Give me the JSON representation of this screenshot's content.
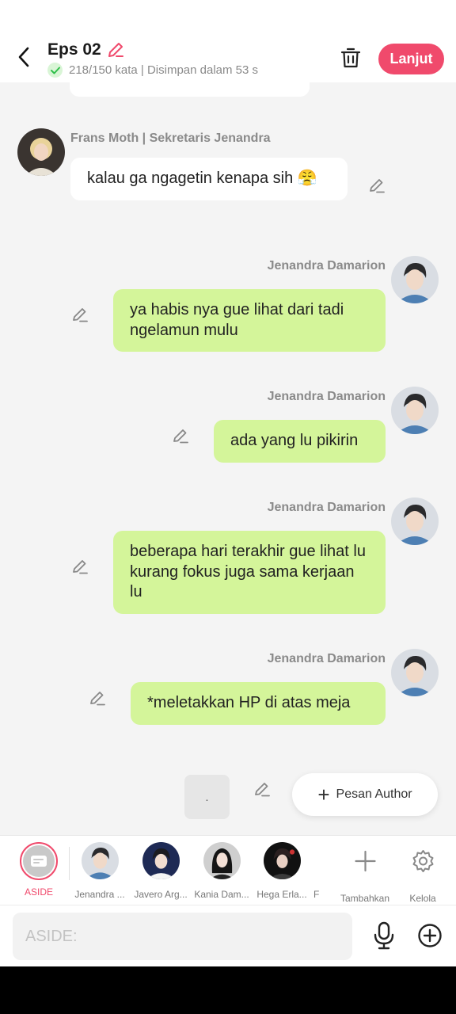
{
  "header": {
    "title": "Eps 02",
    "subtitle": "218/150 kata | Disimpan dalam 53 s",
    "next_label": "Lanjut"
  },
  "messages": [
    {
      "sender": "Frans Moth | Sekretaris Jenandra",
      "side": "left",
      "text": "kalau ga ngagetin kenapa sih 😤"
    },
    {
      "sender": "Jenandra Damarion",
      "side": "right",
      "text": "ya habis nya gue lihat dari tadi ngelamun mulu"
    },
    {
      "sender": "Jenandra Damarion",
      "side": "right",
      "text": "ada yang lu pikirin"
    },
    {
      "sender": "Jenandra Damarion",
      "side": "right",
      "text": "beberapa hari terakhir gue lihat lu kurang fokus juga sama kerjaan lu"
    },
    {
      "sender": "Jenandra Damarion",
      "side": "right",
      "text": "*meletakkan HP di atas meja"
    }
  ],
  "draft_box": ".",
  "author_button": "Pesan Author",
  "characters": {
    "aside": "ASIDE",
    "items": [
      "Jenandra ...",
      "Javero Arg...",
      "Kania Dam...",
      "Hega Erla...",
      "F"
    ],
    "add_label": "Tambahkan",
    "manage_label": "Kelola"
  },
  "input": {
    "placeholder": "ASIDE:"
  },
  "colors": {
    "accent": "#f04a6c",
    "bubble_right": "#d4f59a",
    "bubble_left": "#ffffff"
  }
}
